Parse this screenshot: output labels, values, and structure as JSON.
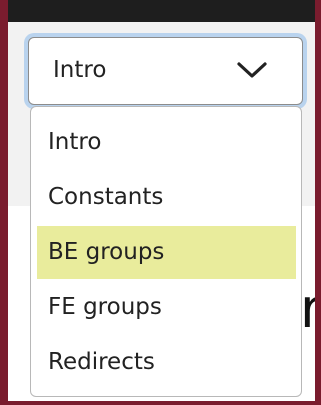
{
  "select": {
    "value": "Intro",
    "options": [
      "Intro",
      "Constants",
      "BE groups",
      "FE groups",
      "Redirects"
    ],
    "highlighted_option": "BE groups"
  },
  "background": {
    "partial_text": "r"
  },
  "icons": {
    "chevron": "chevron-down-icon"
  },
  "colors": {
    "frame": "#7a1c2e",
    "top_bar": "#1e1e1e",
    "focus_ring": "#b9d3ee",
    "highlight": "#e9ec9c"
  }
}
